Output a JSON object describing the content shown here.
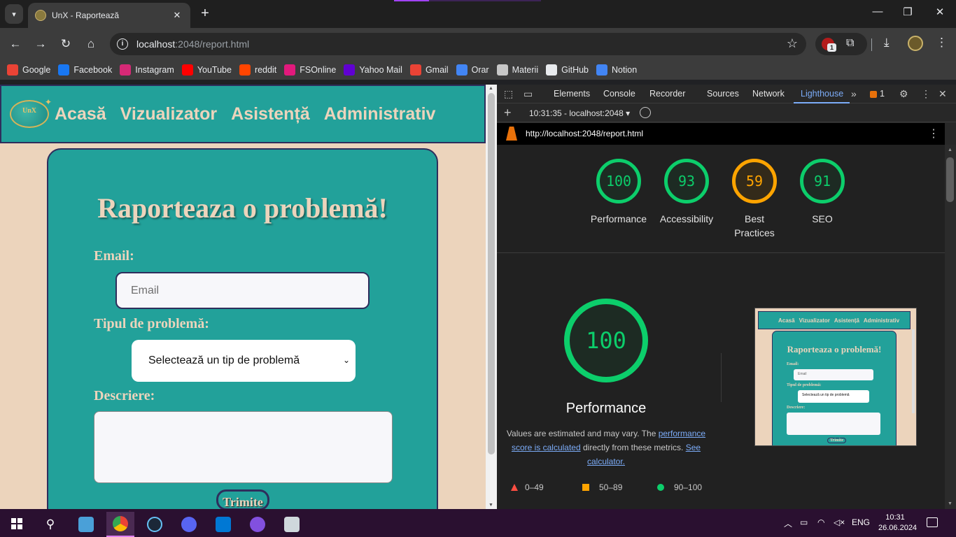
{
  "browser": {
    "tab_title": "UnX - Raportează",
    "url_host": "localhost",
    "url_rest": ":2048/report.html",
    "ext_badge": "1"
  },
  "bookmarks": [
    {
      "label": "Google",
      "color": "#ea4335"
    },
    {
      "label": "Facebook",
      "color": "#1877f2"
    },
    {
      "label": "Instagram",
      "color": "#d62976"
    },
    {
      "label": "YouTube",
      "color": "#ff0000"
    },
    {
      "label": "reddit",
      "color": "#ff4500"
    },
    {
      "label": "FSOnline",
      "color": "#e2197c"
    },
    {
      "label": "Yahoo Mail",
      "color": "#6001d2"
    },
    {
      "label": "Gmail",
      "color": "#ea4335"
    },
    {
      "label": "Orar",
      "color": "#4285f4"
    },
    {
      "label": "Materii",
      "color": "#c7c7c7"
    },
    {
      "label": "GitHub",
      "color": "#e8eaed"
    },
    {
      "label": "Notion",
      "color": "#4285f4"
    }
  ],
  "site": {
    "logo_text": "UnX",
    "nav": [
      "Acasă",
      "Vizualizator",
      "Asistență",
      "Administrativ"
    ],
    "heading": "Raporteaza o problemă!",
    "email_label": "Email:",
    "email_placeholder": "Email",
    "type_label": "Tipul de problemă:",
    "type_selected": "Selectează un tip de problemă",
    "desc_label": "Descriere:",
    "submit_label": "Trimite"
  },
  "devtools": {
    "tabs": [
      "Elements",
      "Console",
      "Recorder",
      "Sources",
      "Network",
      "Lighthouse"
    ],
    "active_tab": "Lighthouse",
    "issues_count": "1",
    "session": "10:31:35 - localhost:2048",
    "report_url": "http://localhost:2048/report.html",
    "scores": [
      {
        "value": "100",
        "label": "Performance",
        "status": "green"
      },
      {
        "value": "93",
        "label": "Accessibility",
        "status": "green"
      },
      {
        "value": "59",
        "label": "Best Practices",
        "status": "orange"
      },
      {
        "value": "91",
        "label": "SEO",
        "status": "green"
      }
    ],
    "big_score": "100",
    "big_label": "Performance",
    "note_prefix": "Values are estimated and may vary. The ",
    "note_link1": "performance score is calculated",
    "note_mid": " directly from these metrics. ",
    "note_link2": "See calculator.",
    "legend": [
      "0–49",
      "50–89",
      "90–100"
    ],
    "thumb": {
      "nav": [
        "Acasă",
        "Vizualizator",
        "Asistență",
        "Administrativ"
      ],
      "heading": "Raporteaza o problemă!",
      "email_label": "Email:",
      "email_placeholder": "Email",
      "type_label": "Tipul de problemă:",
      "type_selected": "Selectează un tip de problemă",
      "desc_label": "Descriere:",
      "submit_label": "Trimite"
    }
  },
  "taskbar": {
    "lang": "ENG",
    "time": "10:31",
    "date": "26.06.2024"
  }
}
